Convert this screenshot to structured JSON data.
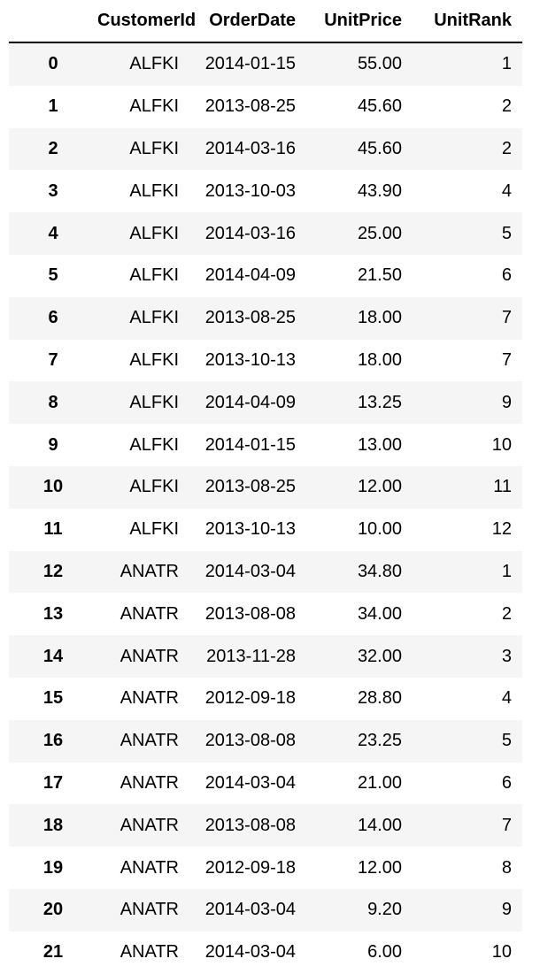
{
  "table": {
    "columns": [
      "",
      "CustomerId",
      "OrderDate",
      "UnitPrice",
      "UnitRank"
    ],
    "rows": [
      [
        "0",
        "ALFKI",
        "2014-01-15",
        "55.00",
        "1"
      ],
      [
        "1",
        "ALFKI",
        "2013-08-25",
        "45.60",
        "2"
      ],
      [
        "2",
        "ALFKI",
        "2014-03-16",
        "45.60",
        "2"
      ],
      [
        "3",
        "ALFKI",
        "2013-10-03",
        "43.90",
        "4"
      ],
      [
        "4",
        "ALFKI",
        "2014-03-16",
        "25.00",
        "5"
      ],
      [
        "5",
        "ALFKI",
        "2014-04-09",
        "21.50",
        "6"
      ],
      [
        "6",
        "ALFKI",
        "2013-08-25",
        "18.00",
        "7"
      ],
      [
        "7",
        "ALFKI",
        "2013-10-13",
        "18.00",
        "7"
      ],
      [
        "8",
        "ALFKI",
        "2014-04-09",
        "13.25",
        "9"
      ],
      [
        "9",
        "ALFKI",
        "2014-01-15",
        "13.00",
        "10"
      ],
      [
        "10",
        "ALFKI",
        "2013-08-25",
        "12.00",
        "11"
      ],
      [
        "11",
        "ALFKI",
        "2013-10-13",
        "10.00",
        "12"
      ],
      [
        "12",
        "ANATR",
        "2014-03-04",
        "34.80",
        "1"
      ],
      [
        "13",
        "ANATR",
        "2013-08-08",
        "34.00",
        "2"
      ],
      [
        "14",
        "ANATR",
        "2013-11-28",
        "32.00",
        "3"
      ],
      [
        "15",
        "ANATR",
        "2012-09-18",
        "28.80",
        "4"
      ],
      [
        "16",
        "ANATR",
        "2013-08-08",
        "23.25",
        "5"
      ],
      [
        "17",
        "ANATR",
        "2014-03-04",
        "21.00",
        "6"
      ],
      [
        "18",
        "ANATR",
        "2013-08-08",
        "14.00",
        "7"
      ],
      [
        "19",
        "ANATR",
        "2012-09-18",
        "12.00",
        "8"
      ],
      [
        "20",
        "ANATR",
        "2014-03-04",
        "9.20",
        "9"
      ],
      [
        "21",
        "ANATR",
        "2014-03-04",
        "6.00",
        "10"
      ]
    ]
  }
}
